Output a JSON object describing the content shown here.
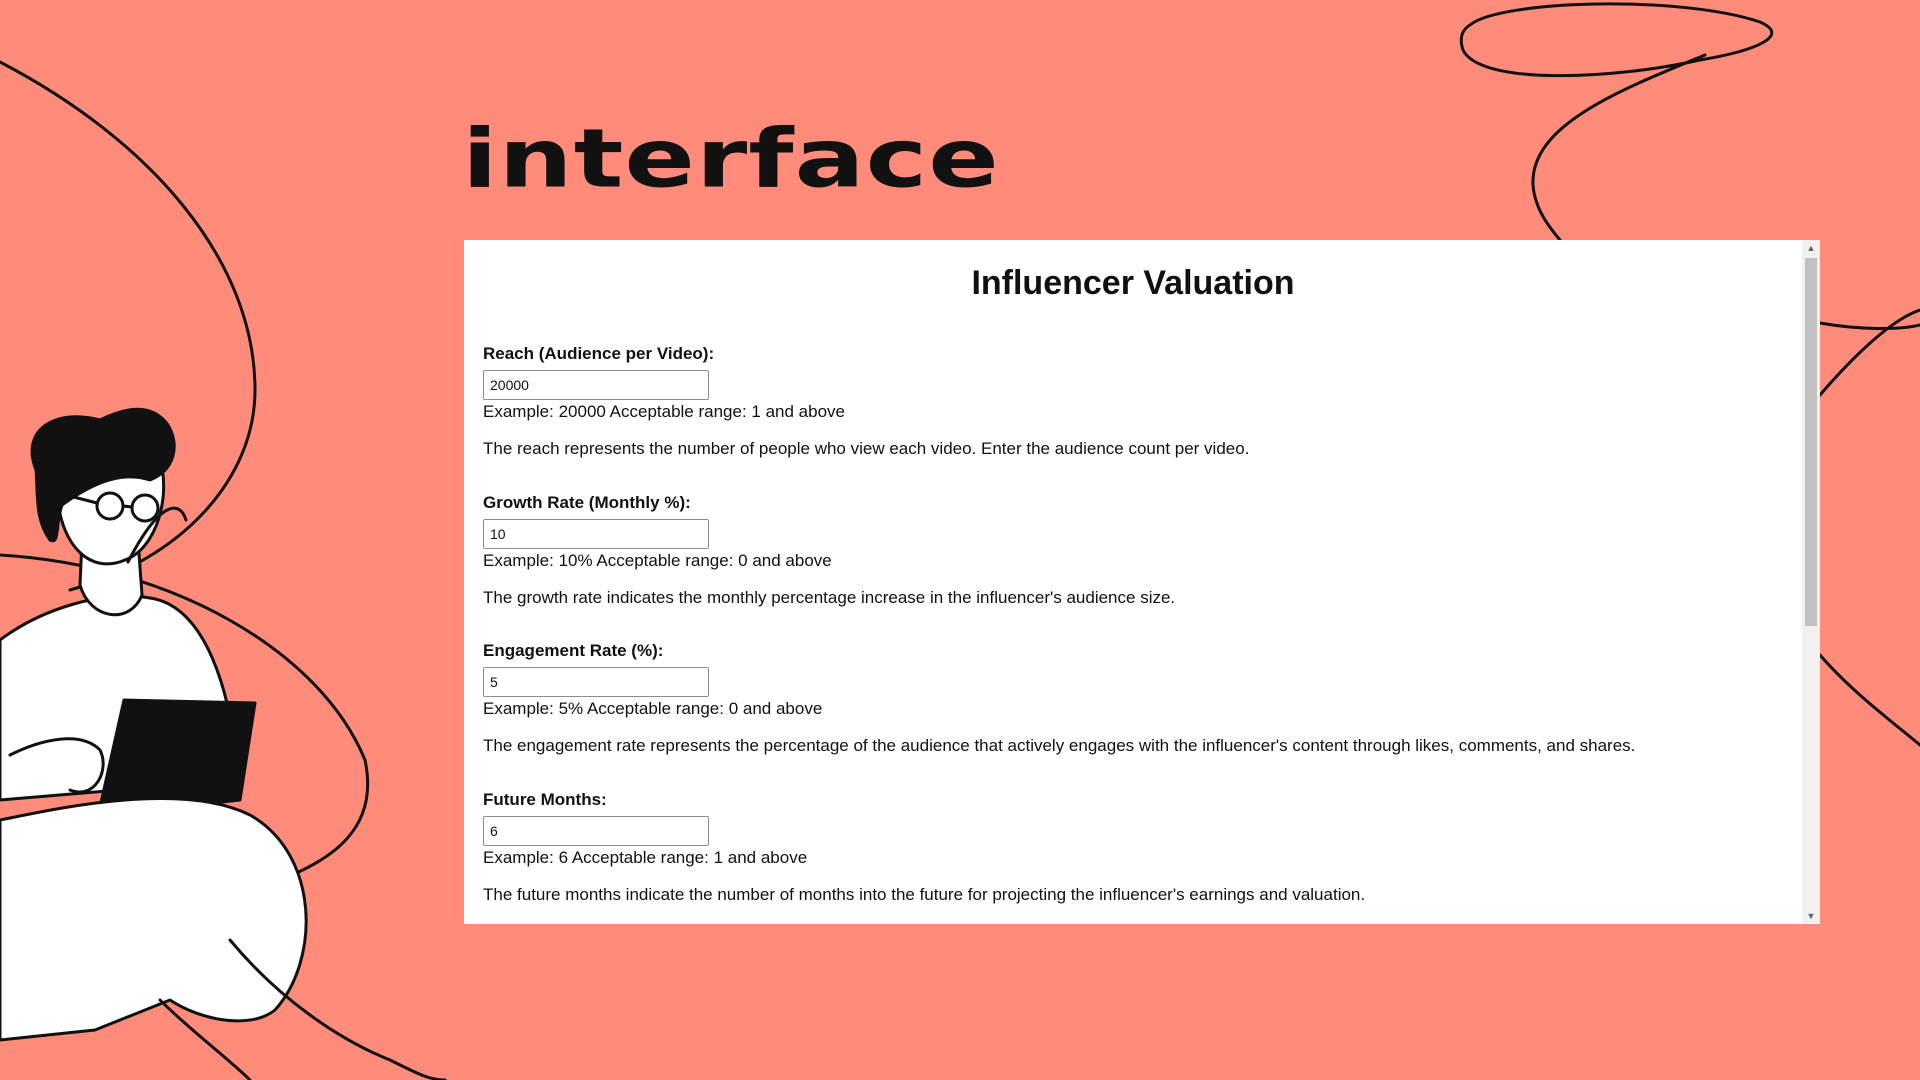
{
  "slide": {
    "title": "Interface"
  },
  "app": {
    "title": "Influencer Valuation"
  },
  "fields": [
    {
      "label": "Reach (Audience per Video):",
      "value": "20000",
      "example": "Example: 20000 Acceptable range: 1 and above",
      "description": "The reach represents the number of people who view each video. Enter the audience count per video."
    },
    {
      "label": "Growth Rate (Monthly %):",
      "value": "10",
      "example": "Example: 10% Acceptable range: 0 and above",
      "description": "The growth rate indicates the monthly percentage increase in the influencer's audience size."
    },
    {
      "label": "Engagement Rate (%):",
      "value": "5",
      "example": "Example: 5% Acceptable range: 0 and above",
      "description": "The engagement rate represents the percentage of the audience that actively engages with the influencer's content through likes, comments, and shares."
    },
    {
      "label": "Future Months:",
      "value": "6",
      "example": "Example: 6 Acceptable range: 1 and above",
      "description": "The future months indicate the number of months into the future for projecting the influencer's earnings and valuation."
    }
  ],
  "colors": {
    "background": "#ff8c7a",
    "ink": "#111111",
    "panel": "#ffffff"
  },
  "icons": {
    "scroll_up": "triangle-up-icon",
    "scroll_down": "triangle-down-icon"
  }
}
